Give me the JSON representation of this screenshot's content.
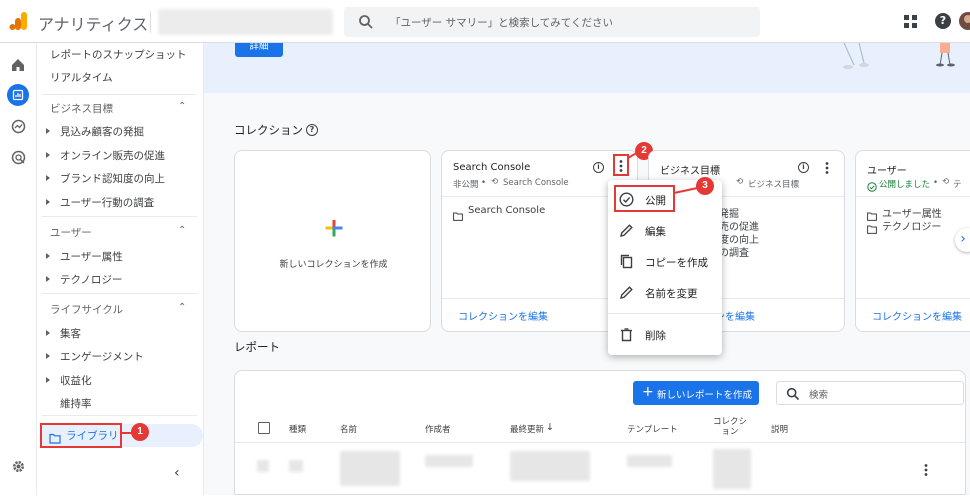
{
  "app": {
    "title": "アナリティクス",
    "account": ""
  },
  "search": {
    "placeholder": "「ユーザー サマリー」と検索してみてください"
  },
  "nav": {
    "snapshot": "レポートのスナップショット",
    "realtime": "リアルタイム",
    "sections": [
      {
        "title": "ビジネス目標",
        "items": [
          "見込み顧客の発掘",
          "オンライン販売の促進",
          "ブランド認知度の向上",
          "ユーザー行動の調査"
        ]
      },
      {
        "title": "ユーザー",
        "items": [
          "ユーザー属性",
          "テクノロジー"
        ]
      },
      {
        "title": "ライフサイクル",
        "items": [
          "集客",
          "エンゲージメント",
          "収益化",
          "維持率"
        ]
      }
    ],
    "library": "ライブラリ"
  },
  "banner": {
    "details_button": "詳細"
  },
  "collections": {
    "heading": "コレクション",
    "create_label": "新しいコレクションを作成",
    "cards": [
      {
        "title": "Search Console",
        "status": "非公開",
        "sync": "Search Console",
        "items": [
          "Search Console"
        ],
        "edit_link": "コレクションを編集"
      },
      {
        "title": "ビジネス目標",
        "status": "",
        "sync": "ビジネス目標",
        "items": [
          "の発掘",
          "販売の促進",
          "知度の向上",
          "動の調査"
        ],
        "edit_link": "コレクションを編集"
      },
      {
        "title": "ユーザー",
        "status": "公開しました",
        "sync": "テ",
        "items": [
          "ユーザー属性",
          "テクノロジー"
        ],
        "edit_link": "コレクションを編集"
      }
    ]
  },
  "menu": {
    "items": [
      "公開",
      "編集",
      "コピーを作成",
      "名前を変更",
      "削除"
    ]
  },
  "reports": {
    "heading": "レポート",
    "create_button": "新しいレポートを作成",
    "search_placeholder": "検索",
    "columns": [
      "種類",
      "名前",
      "作成者",
      "最終更新",
      "テンプレート",
      "コレクション",
      "説明"
    ]
  },
  "annotations": {
    "b1": "1",
    "b2": "2",
    "b3": "3"
  },
  "colors": {
    "accent": "#1a73e8",
    "annotation": "#e53935",
    "logo_orange": "#f9ab00",
    "logo_dark": "#e37400"
  }
}
